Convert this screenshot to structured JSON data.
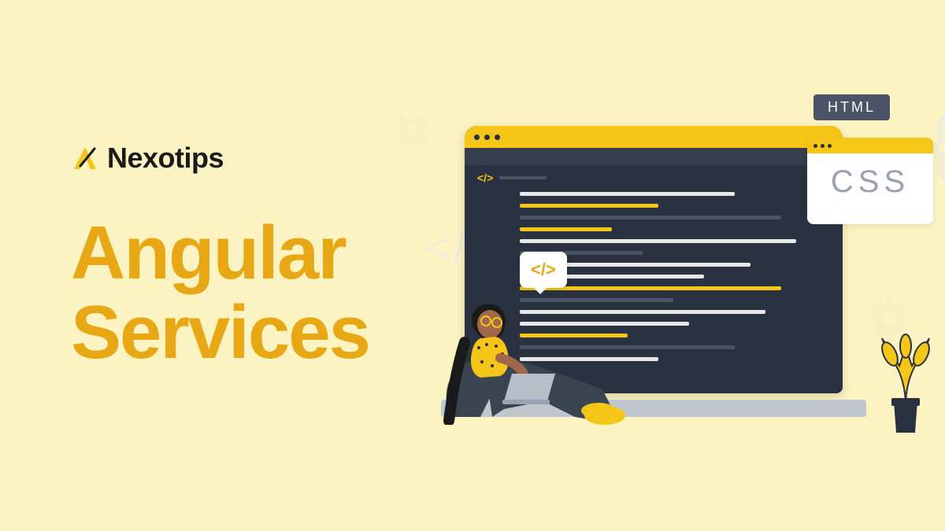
{
  "brand": "Nexotips",
  "title_line1": "Angular",
  "title_line2": "Services",
  "html_badge": "HTML",
  "css_label": "CSS",
  "speech_tag": "</>",
  "code_tag": "</>"
}
